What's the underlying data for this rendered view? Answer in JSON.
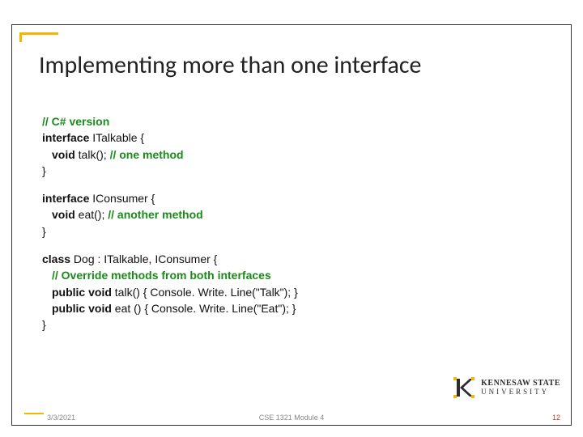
{
  "title": "Implementing more than one interface",
  "code": {
    "c1": "// C# version",
    "l2a": "interface",
    "l2b": " ITalkable {",
    "l3a": "void",
    "l3b": " talk();  ",
    "l3c": "// one method",
    "l4": "}",
    "l5a": "interface",
    "l5b": " IConsumer {",
    "l6a": "void",
    "l6b": " eat();   ",
    "l6c": "// another method",
    "l7": "}",
    "l8a": "class",
    "l8b": " Dog : ITalkable, IConsumer {",
    "l9": "// Override methods from both interfaces",
    "l10a": "public void",
    "l10b": " talk() { Console. Write. Line(\"Talk\"); }",
    "l11a": "public void",
    "l11b": " eat () { Console. Write. Line(\"Eat\"); }",
    "l12": "}"
  },
  "footer": {
    "date": "3/3/2021",
    "center": "CSE 1321 Module 4",
    "page": "12"
  },
  "logo": {
    "line1": "KENNESAW STATE",
    "line2": "UNIVERSITY"
  }
}
